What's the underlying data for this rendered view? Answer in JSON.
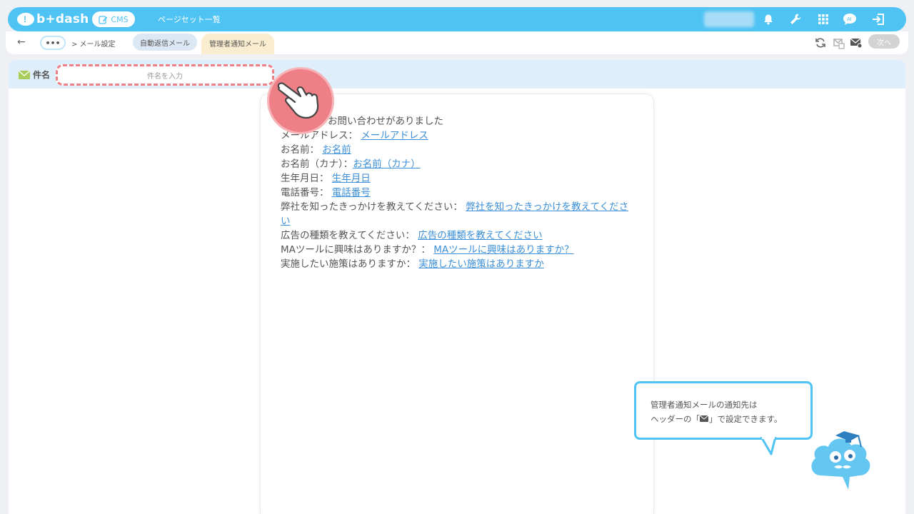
{
  "header": {
    "logo": "b+dash",
    "cms_label": "CMS",
    "nav_link": "ページセット一覧",
    "icons": [
      "bell-icon",
      "wrench-icon",
      "grid-icon",
      "chat-icon",
      "logout-icon"
    ]
  },
  "subbar": {
    "back": "←",
    "more": "•••",
    "breadcrumb": "> メール設定",
    "tabs": [
      "自動返信メール",
      "管理者通知メール"
    ],
    "active_tab": "管理者通知メール",
    "next_label": "次へ"
  },
  "subject": {
    "label": "件名",
    "placeholder": "件名を入力"
  },
  "mail_body": {
    "lines": [
      {
        "label": "お問い合わせがありました",
        "value": ""
      },
      {
        "label": "メールアドレス：",
        "value": "メールアドレス"
      },
      {
        "label": "お名前：",
        "value": "お名前"
      },
      {
        "label": "お名前（カナ）：",
        "value": "お名前（カナ）"
      },
      {
        "label": "生年月日：",
        "value": "生年月日"
      },
      {
        "label": "電話番号：",
        "value": "電話番号"
      },
      {
        "label": "弊社を知ったきっかけを教えてください：",
        "value": "弊社を知ったきっかけを教えてください"
      },
      {
        "label": "広告の種類を教えてください：",
        "value": "広告の種類を教えてください"
      },
      {
        "label": "MAツールに興味はありますか？：",
        "value": "MAツールに興味はありますか？"
      },
      {
        "label": "実施したい施策はありますか：",
        "value": "実施したい施策はありますか"
      }
    ]
  },
  "tooltip": {
    "line1": "管理者通知メールの通知先は",
    "line2_prefix": "ヘッダーの「",
    "line2_suffix": "」で設定できます。"
  },
  "colors": {
    "brand": "#4fc3f3",
    "accent_red": "#ef7f86",
    "link": "#3c8fd8"
  }
}
